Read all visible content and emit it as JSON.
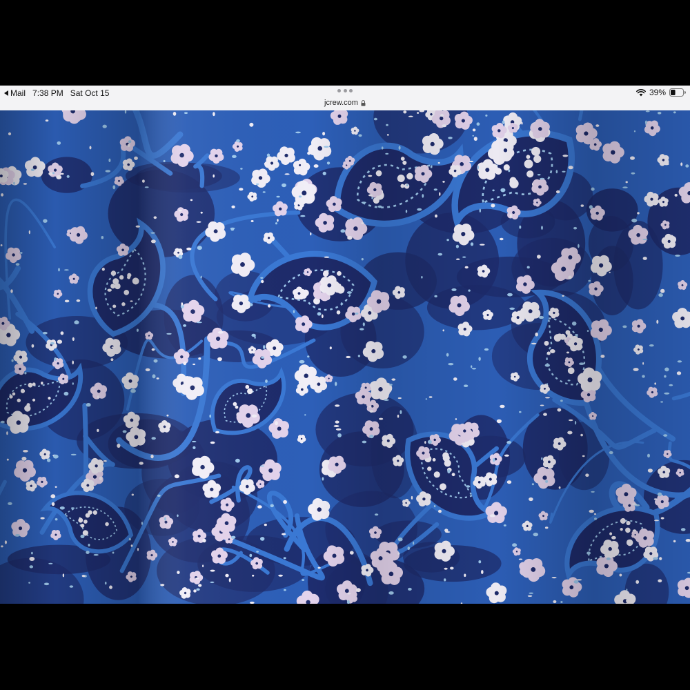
{
  "status_bar": {
    "back_app": "Mail",
    "time": "7:38 PM",
    "date": "Sat Oct 15",
    "battery_percent": "39%",
    "battery_level": 0.39
  },
  "address_bar": {
    "url": "jcrew.com"
  },
  "icons": {
    "back": "back-arrow-icon",
    "wifi": "wifi-icon",
    "battery": "battery-icon",
    "lock": "lock-icon",
    "multitask": "ellipsis-icon"
  },
  "colors": {
    "fabric_base": "#2d5fb8",
    "fabric_navy": "#1e2b6b",
    "fabric_bright": "#3a78d4",
    "flower_pink": "#e3d3ec",
    "flower_white": "#f1eef7",
    "accent_light": "#9fc9ec"
  }
}
